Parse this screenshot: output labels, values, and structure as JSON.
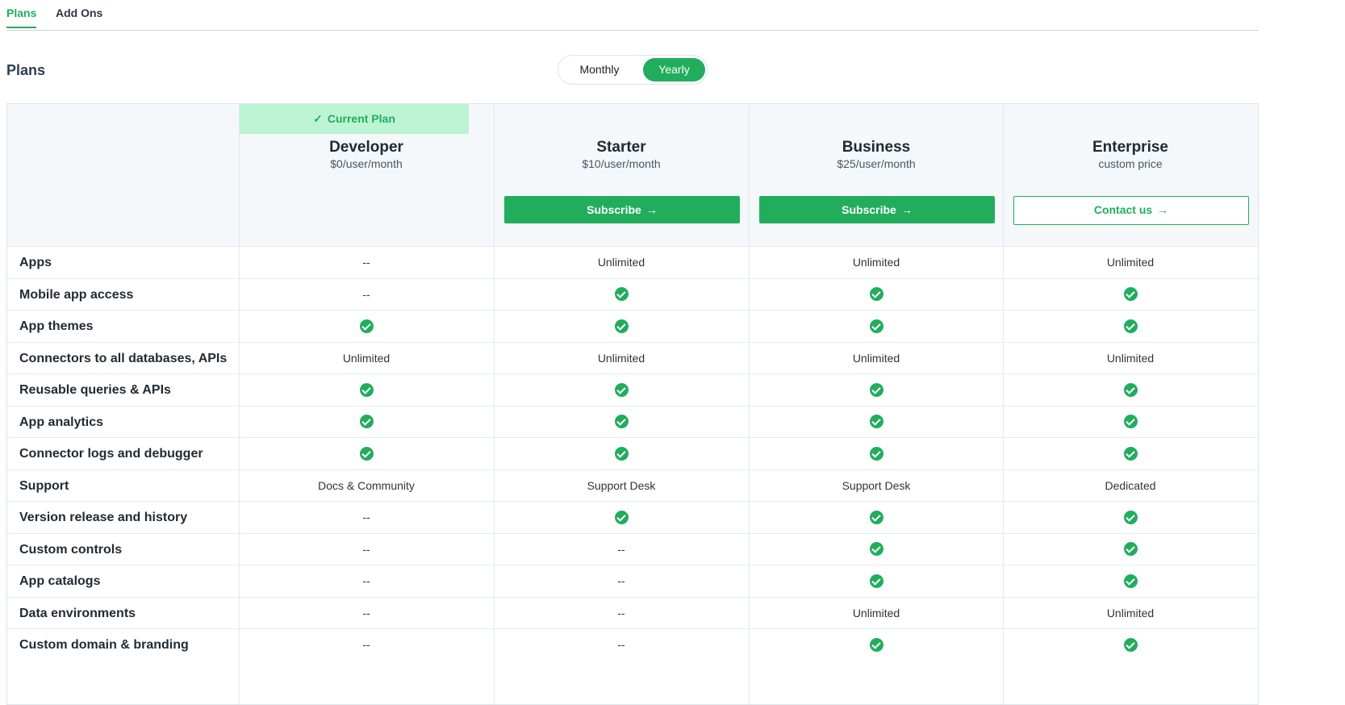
{
  "tabs": {
    "plans": "Plans",
    "addons": "Add Ons"
  },
  "page_title": "Plans",
  "billing_toggle": {
    "monthly": "Monthly",
    "yearly": "Yearly",
    "selected": "Yearly"
  },
  "current_plan_label": "Current Plan",
  "plans": [
    {
      "name": "Developer",
      "price": "$0/user/month",
      "current": true
    },
    {
      "name": "Starter",
      "price": "$10/user/month",
      "button": "Subscribe",
      "button_style": "solid"
    },
    {
      "name": "Business",
      "price": "$25/user/month",
      "button": "Subscribe",
      "button_style": "solid"
    },
    {
      "name": "Enterprise",
      "price": "custom price",
      "button": "Contact us",
      "button_style": "outline"
    }
  ],
  "features": [
    {
      "name": "Apps",
      "values": [
        "--",
        "Unlimited",
        "Unlimited",
        "Unlimited"
      ]
    },
    {
      "name": "Mobile app access",
      "values": [
        "--",
        "check",
        "check",
        "check"
      ]
    },
    {
      "name": "App themes",
      "values": [
        "check",
        "check",
        "check",
        "check"
      ]
    },
    {
      "name": "Connectors to all databases, APIs",
      "values": [
        "Unlimited",
        "Unlimited",
        "Unlimited",
        "Unlimited"
      ]
    },
    {
      "name": "Reusable queries & APIs",
      "values": [
        "check",
        "check",
        "check",
        "check"
      ]
    },
    {
      "name": "App analytics",
      "values": [
        "check",
        "check",
        "check",
        "check"
      ]
    },
    {
      "name": "Connector logs and debugger",
      "values": [
        "check",
        "check",
        "check",
        "check"
      ]
    },
    {
      "name": "Support",
      "values": [
        "Docs & Community",
        "Support Desk",
        "Support Desk",
        "Dedicated"
      ]
    },
    {
      "name": "Version release and history",
      "values": [
        "--",
        "check",
        "check",
        "check"
      ]
    },
    {
      "name": "Custom controls",
      "values": [
        "--",
        "--",
        "check",
        "check"
      ]
    },
    {
      "name": "App catalogs",
      "values": [
        "--",
        "--",
        "check",
        "check"
      ]
    },
    {
      "name": "Data environments",
      "values": [
        "--",
        "--",
        "Unlimited",
        "Unlimited"
      ]
    },
    {
      "name": "Custom domain & branding",
      "values": [
        "--",
        "--",
        "check",
        "check"
      ]
    }
  ],
  "colors": {
    "accent": "#22ad5c",
    "current_plan_bg": "#bdf4d3",
    "header_bg": "#f4f8fb"
  },
  "icons": {
    "check": "check-circle-icon",
    "arrow": "arrow-right-icon",
    "current": "checkmark-icon"
  }
}
